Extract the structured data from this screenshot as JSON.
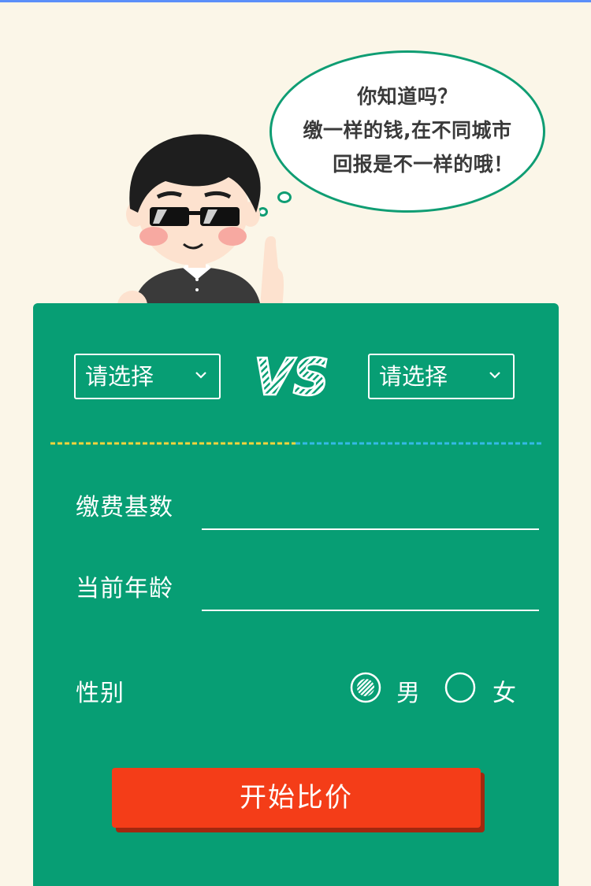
{
  "bubble": {
    "line1": "你知道吗？",
    "line2": "缴一样的钱,在不同城市",
    "line3": "回报是不一样的哦！"
  },
  "compare": {
    "left_select": {
      "value": "请选择"
    },
    "vs_text": "VS",
    "right_select": {
      "value": "请选择"
    }
  },
  "form": {
    "base_label": "缴费基数",
    "base_value": "",
    "age_label": "当前年龄",
    "age_value": "",
    "gender_label": "性别",
    "gender_options": [
      {
        "label": "男",
        "selected": true
      },
      {
        "label": "女",
        "selected": false
      }
    ]
  },
  "start_button": {
    "label": "开始比价"
  },
  "colors": {
    "page_bg": "#fbf6e8",
    "panel": "#079e74",
    "button": "#f43d18",
    "bubble_border": "#0f9d73",
    "divider_left": "#f5d33b",
    "divider_right": "#35b9e6"
  }
}
